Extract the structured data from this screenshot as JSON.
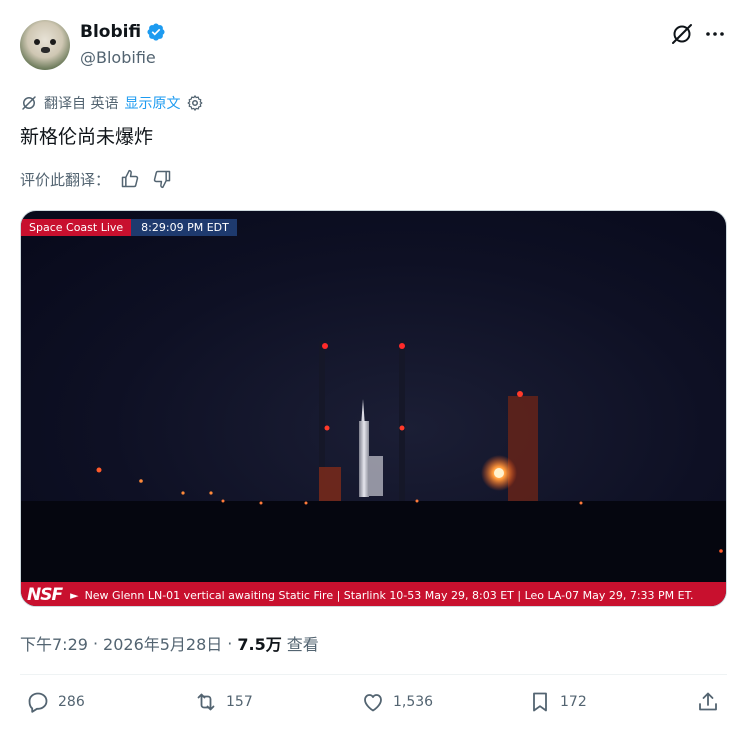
{
  "author": {
    "display_name": "Blobifi",
    "handle": "@Blobifie",
    "verified_icon": "verified-badge-icon",
    "verified_color": "#1d9bf0"
  },
  "header_actions": {
    "grok_icon": "grok-icon",
    "more_icon": "more-horizontal-icon"
  },
  "translation": {
    "label": "翻译自 英语",
    "show_original": "显示原文",
    "settings_icon": "gear-icon"
  },
  "tweet": {
    "text": "新格伦尚未爆炸"
  },
  "rate_translation": {
    "label": "评价此翻译："
  },
  "media": {
    "source_badge": "Space Coast Live",
    "timestamp": "8:29:09 PM EDT",
    "ticker_logo": "NSF",
    "ticker_text": "New Glenn LN-01 vertical awaiting Static Fire | Starlink 10-53 May 29, 8:03 ET | Leo LA-07 May 29, 7:33 PM ET.",
    "brand_color": "#c8102e"
  },
  "meta": {
    "time": "下午7:29",
    "separator": "·",
    "date": "2026年5月28日",
    "views_count": "7.5万",
    "views_label": "查看"
  },
  "actions": {
    "replies": "286",
    "reposts": "157",
    "likes": "1,536",
    "bookmarks": "172"
  }
}
